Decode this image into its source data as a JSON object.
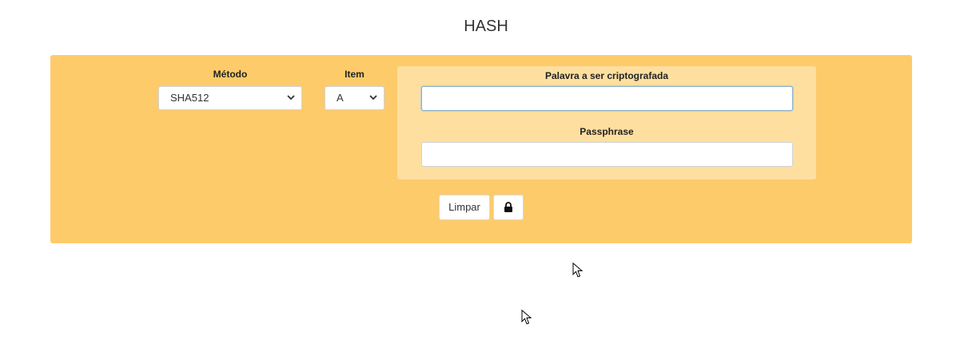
{
  "header": {
    "title": "HASH"
  },
  "form": {
    "method": {
      "label": "Método",
      "selected": "SHA512"
    },
    "item": {
      "label": "Item",
      "selected": "A"
    },
    "word": {
      "label": "Palavra a ser criptografada",
      "value": "",
      "placeholder": ""
    },
    "passphrase": {
      "label": "Passphrase",
      "value": "",
      "placeholder": ""
    }
  },
  "actions": {
    "clear_label": "Limpar",
    "encrypt_icon": "lock-icon"
  },
  "colors": {
    "panel": "#fecb6b",
    "inner_panel": "#fedf9f"
  },
  "icons": {
    "select_arrow": "chevron-down-icon",
    "pointer": "mouse-cursor-icon"
  }
}
